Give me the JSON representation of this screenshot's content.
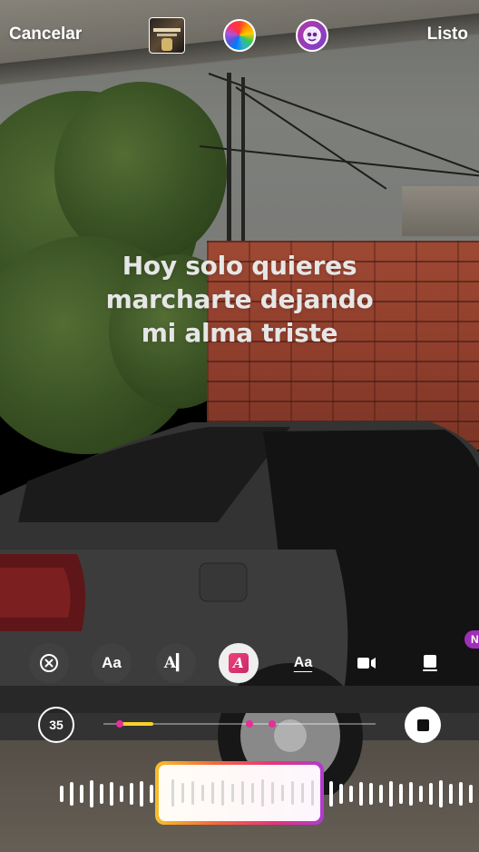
{
  "top_bar": {
    "cancel_label": "Cancelar",
    "done_label": "Listo",
    "album_icon": "album-cover-icon",
    "color_icon": "color-wheel-icon",
    "sticker_icon": "face-sticker-icon"
  },
  "lyrics": {
    "lines": [
      "Hoy solo quieres",
      "marcharte dejando",
      "mi alma triste"
    ]
  },
  "style_toolbar": {
    "items": [
      {
        "name": "remove-style",
        "label": "",
        "icon": "close-circle-icon"
      },
      {
        "name": "style-aa-small",
        "label": "Aa",
        "icon": "text-style-icon"
      },
      {
        "name": "style-ai",
        "label": "A▎",
        "icon": "typewriter-icon"
      },
      {
        "name": "style-active",
        "label": "A",
        "icon": "italic-a-icon"
      },
      {
        "name": "style-underline",
        "label": "Aa",
        "icon": "underline-text-icon"
      },
      {
        "name": "style-video",
        "label": "",
        "icon": "video-card-icon"
      },
      {
        "name": "style-card",
        "label": "",
        "icon": "card-icon"
      }
    ],
    "edge_tag": "N"
  },
  "timeline": {
    "duration": "35",
    "stop_icon": "stop-icon"
  },
  "colors": {
    "accent_pink": "#e82e9a",
    "segment_yellow": "#f7d22a",
    "scrubber_gradient": [
      "#f5c02a",
      "#f26b3a",
      "#e8337a",
      "#b13ad1"
    ]
  }
}
